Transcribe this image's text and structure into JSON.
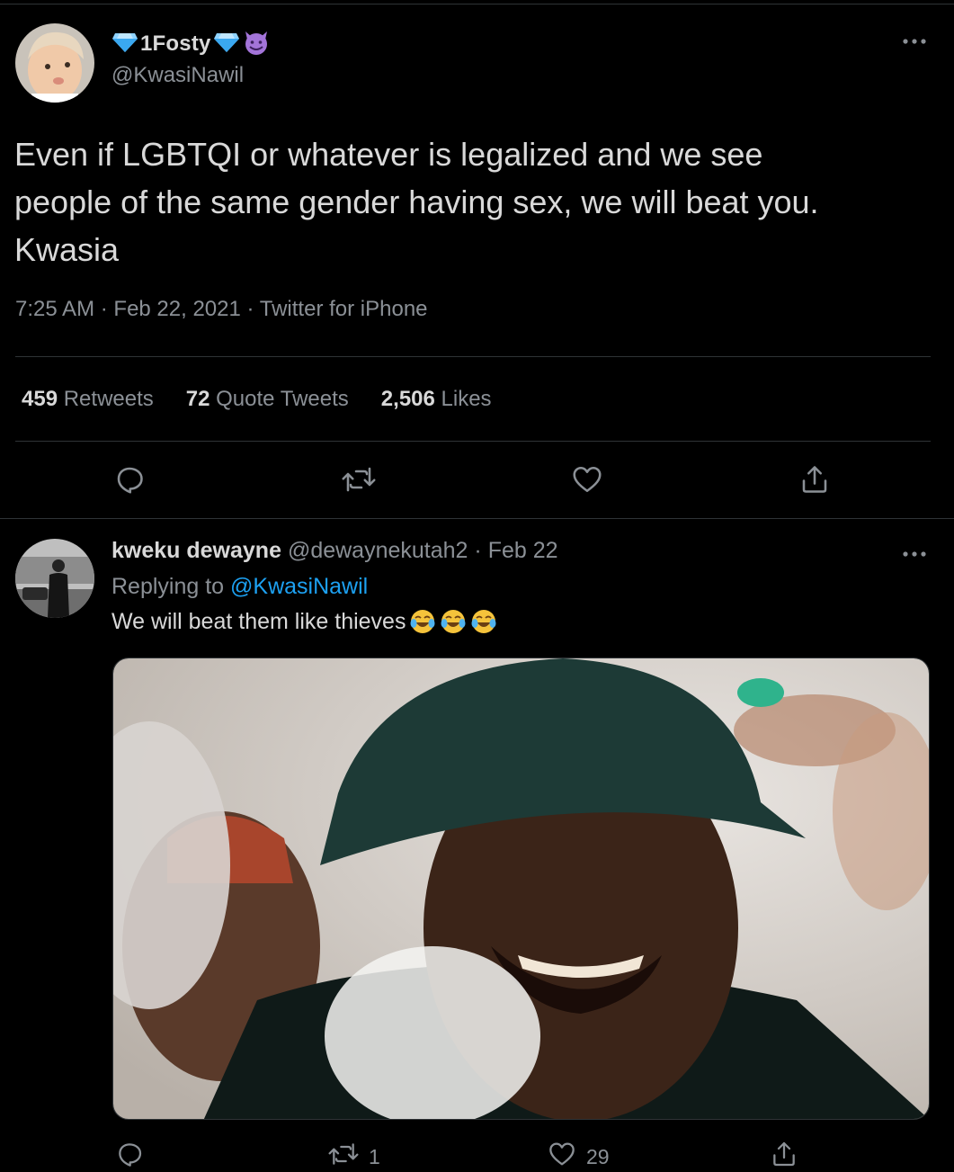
{
  "main_tweet": {
    "display_name": "1Fosty",
    "name_badges": [
      "gem-icon",
      "gem-icon",
      "smiling-imp-icon"
    ],
    "handle": "@KwasiNawil",
    "text": "Even if LGBTQI or whatever is legalized and we see\npeople of the same gender having sex, we will beat you.\nKwasia",
    "time": "7:25 AM",
    "date": "Feb 22, 2021",
    "source": "Twitter for iPhone",
    "retweets_count": "459",
    "retweets_label": "Retweets",
    "quote_count": "72",
    "quote_label": "Quote Tweets",
    "likes_count": "2,506",
    "likes_label": "Likes"
  },
  "reply": {
    "display_name": "kweku dewayne",
    "handle": "@dewaynekutah2",
    "date": "Feb 22",
    "replying_prefix": "Replying to",
    "replying_to": "@KwasiNawil",
    "text": "We will beat them like thieves",
    "emojis": [
      "tears-of-joy-icon",
      "tears-of-joy-icon",
      "tears-of-joy-icon"
    ],
    "retweet_count": "1",
    "like_count": "29"
  },
  "colors": {
    "background": "#000000",
    "primary_text": "#d9d9d9",
    "secondary_text": "#8b9096",
    "link": "#1da1f2",
    "divider": "#2f3336"
  }
}
